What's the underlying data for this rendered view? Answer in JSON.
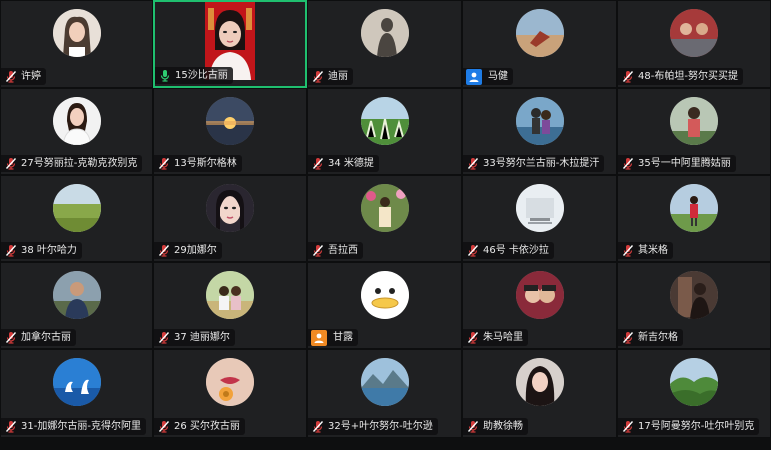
{
  "colors": {
    "active_border": "#1fbf6f",
    "mic_active": "#2ecc71",
    "mic_muted": "#d33b3b",
    "user_badge_blue": "#1e7ce6",
    "user_badge_orange": "#f08a24",
    "tile_bg": "#1f2022"
  },
  "participants": [
    {
      "name": "许婷",
      "icon": "mic-muted-icon",
      "avatar": "avatar-woman-portrait"
    },
    {
      "name": "15沙比古丽",
      "icon": "mic-active-icon",
      "avatar": "video-feed-woman",
      "active": true
    },
    {
      "name": "迪丽",
      "icon": "mic-muted-icon",
      "avatar": "avatar-shadow-wall"
    },
    {
      "name": "马健",
      "icon": "user-badge-icon",
      "avatar": "avatar-beach-figure"
    },
    {
      "name": "48-布帕坦-努尔买买提",
      "icon": "mic-muted-icon",
      "avatar": "avatar-people-car"
    },
    {
      "name": "27号努丽拉-克勒克孜别克",
      "icon": "mic-muted-icon",
      "avatar": "avatar-woman-white-shirt"
    },
    {
      "name": "13号斯尔格林",
      "icon": "mic-muted-icon",
      "avatar": "avatar-sunset-lake"
    },
    {
      "name": "34 米德提",
      "icon": "mic-muted-icon",
      "avatar": "avatar-green-field"
    },
    {
      "name": "33号努尔兰古丽-木拉提汗",
      "icon": "mic-muted-icon",
      "avatar": "avatar-couple-water"
    },
    {
      "name": "35号一中阿里腾姑丽",
      "icon": "mic-muted-icon",
      "avatar": "avatar-woman-outdoor"
    },
    {
      "name": "38  叶尔哈力",
      "icon": "mic-muted-icon",
      "avatar": "avatar-grassland"
    },
    {
      "name": "29加娜尔",
      "icon": "mic-muted-icon",
      "avatar": "avatar-woman-closeup"
    },
    {
      "name": "吾拉西",
      "icon": "mic-muted-icon",
      "avatar": "avatar-woman-flowers"
    },
    {
      "name": "46号  卡依沙拉",
      "icon": "mic-muted-icon",
      "avatar": "avatar-snow-text"
    },
    {
      "name": "其米格",
      "icon": "mic-muted-icon",
      "avatar": "avatar-red-figure-field"
    },
    {
      "name": "加拿尔古丽",
      "icon": "mic-muted-icon",
      "avatar": "avatar-man-sitting"
    },
    {
      "name": "37 迪丽娜尔",
      "icon": "mic-muted-icon",
      "avatar": "avatar-two-girls"
    },
    {
      "name": "甘露",
      "icon": "user-badge-icon-orange",
      "avatar": "avatar-cartoon-duck"
    },
    {
      "name": "朱马哈里",
      "icon": "mic-muted-icon",
      "avatar": "avatar-couple-selfie"
    },
    {
      "name": "新吉尔格",
      "icon": "mic-muted-icon",
      "avatar": "avatar-dark-figure"
    },
    {
      "name": "31-加娜尔古丽-克得尔阿里",
      "icon": "mic-muted-icon",
      "avatar": "avatar-swans-blue"
    },
    {
      "name": "26 买尔孜古丽",
      "icon": "mic-muted-icon",
      "avatar": "avatar-lips-flower"
    },
    {
      "name": "32号+叶尔努尔-吐尔逊",
      "icon": "mic-muted-icon",
      "avatar": "avatar-mountain-lake"
    },
    {
      "name": "助教徐畅",
      "icon": "mic-muted-icon",
      "avatar": "avatar-woman-hair"
    },
    {
      "name": "17号阿曼努尔-吐尔叶别克",
      "icon": "mic-muted-icon",
      "avatar": "avatar-green-hills"
    }
  ]
}
